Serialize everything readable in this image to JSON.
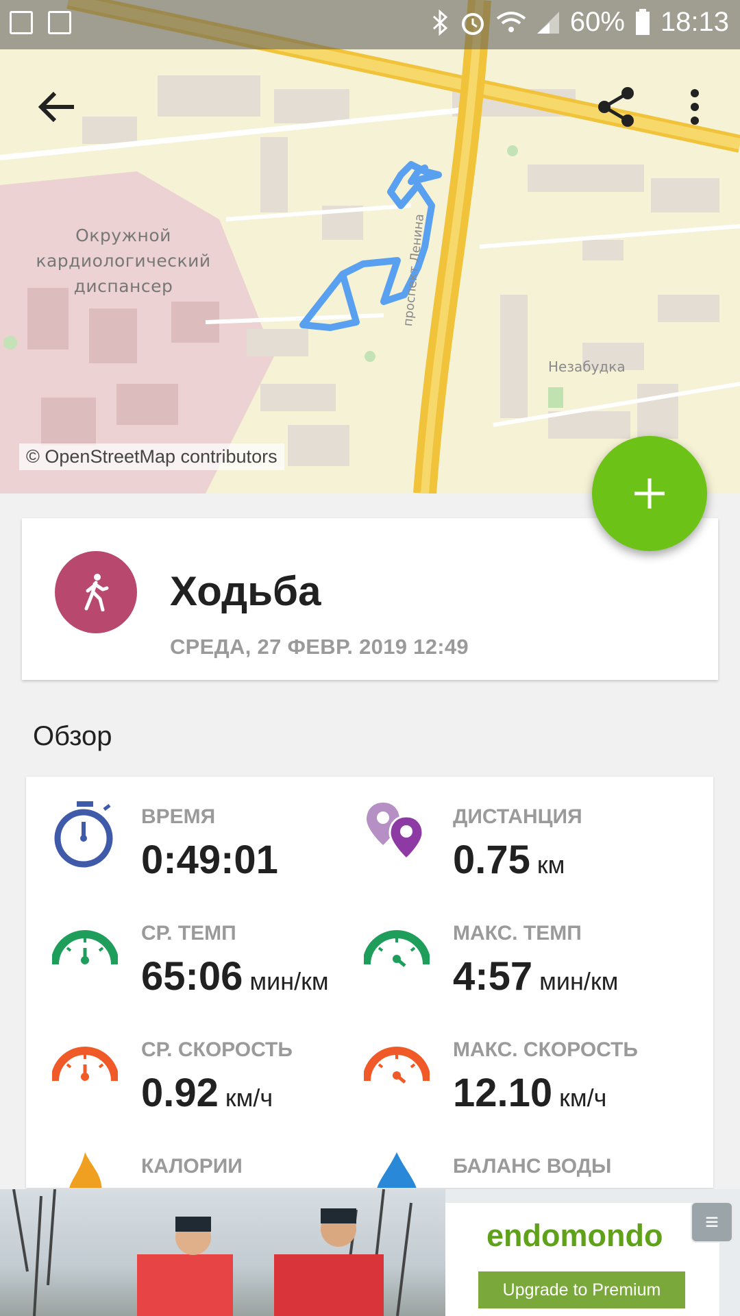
{
  "status_bar": {
    "battery": "60%",
    "time": "18:13",
    "icons": [
      "checklist-icon",
      "image-icon",
      "bluetooth-icon",
      "alarm-icon",
      "wifi-icon",
      "signal-icon",
      "battery-icon"
    ]
  },
  "map": {
    "label_hospital": "Окружной кардиологический диспансер",
    "label_flower": "Незабудка",
    "label_street": "проспект Ленина",
    "attribution": "© OpenStreetMap contributors",
    "route_color": "#5aa0f0"
  },
  "toolbar": {
    "icons": [
      "back-arrow-icon",
      "share-icon",
      "more-vert-icon"
    ]
  },
  "fab": {
    "icon": "plus-icon",
    "color": "#6cc216"
  },
  "workout": {
    "title": "Ходьба",
    "date": "СРЕДА, 27 ФЕВР. 2019 12:49",
    "avatar_color": "#b8486d",
    "icon": "walking-person-icon"
  },
  "overview": {
    "title": "Обзор",
    "stats": [
      {
        "label": "ВРЕМЯ",
        "value": "0:49:01",
        "unit": "",
        "icon": "stopwatch-icon",
        "color": "#3f5aa8"
      },
      {
        "label": "ДИСТАНЦИЯ",
        "value": "0.75",
        "unit": "км",
        "icon": "location-pins-icon",
        "color": "#8e3aa5"
      },
      {
        "label": "СР. ТЕМП",
        "value": "65:06",
        "unit": "мин/км",
        "icon": "speedometer-icon",
        "color": "#1e9e5a"
      },
      {
        "label": "МАКС. ТЕМП",
        "value": "4:57",
        "unit": "мин/км",
        "icon": "speedometer-icon",
        "color": "#1e9e5a"
      },
      {
        "label": "СР. СКОРОСТЬ",
        "value": "0.92",
        "unit": "км/ч",
        "icon": "speedometer-icon",
        "color": "#f05a28"
      },
      {
        "label": "МАКС. СКОРОСТЬ",
        "value": "12.10",
        "unit": "км/ч",
        "icon": "speedometer-icon",
        "color": "#f05a28"
      },
      {
        "label": "КАЛОРИИ",
        "value": "",
        "unit": "",
        "icon": "flame-icon",
        "color": "#f0a020"
      },
      {
        "label": "БАЛАНС ВОДЫ",
        "value": "",
        "unit": "",
        "icon": "water-drop-icon",
        "color": "#2a88d8"
      }
    ]
  },
  "ad": {
    "brand": "endomondo",
    "button": "Upgrade to Premium",
    "brand_color": "#5fa21a"
  }
}
